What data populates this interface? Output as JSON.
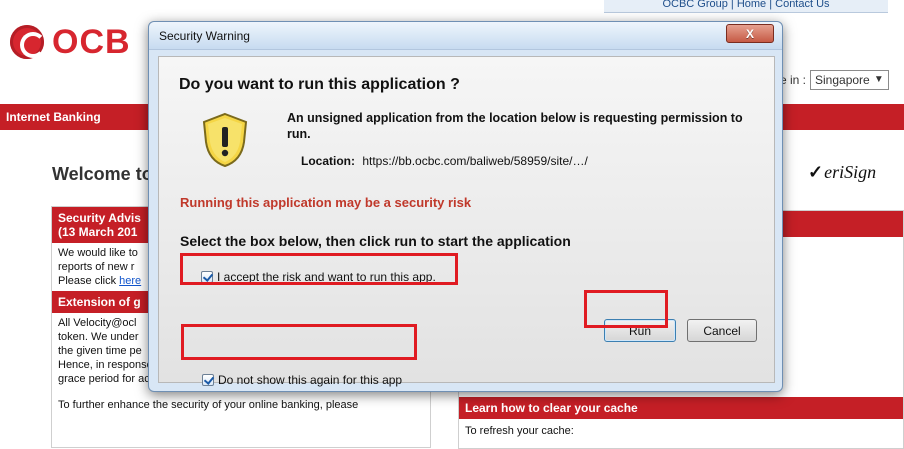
{
  "page": {
    "top_links": "OCBC Group | Home | Contact Us",
    "logo_text": "OCB",
    "country_label": "e in :",
    "country_value": "Singapore",
    "internet_banking": "Internet Banking",
    "welcome": "Welcome to",
    "verisign": "eriSign",
    "left_panel": {
      "security_header_line1": "Security Advis",
      "security_header_line2": "(13 March 201",
      "security_text_line1": "We would like to",
      "security_text_line2": "reports of new r",
      "security_text_line3_prefix": "Please click ",
      "security_text_link": "here",
      "extension_header": "Extension of g",
      "ext_line1": "All Velocity@ocl",
      "ext_line2": "token. We under",
      "ext_line3": "the given time pe",
      "ext_line4": "Hence, in response to feedback from you, we have extended the",
      "ext_line5": "grace period for activation of the new token till further notice.",
      "ext_line6": "To further enhance the security of your online banking, please"
    },
    "right_panel": {
      "cache_header": "Learn how to clear your cache",
      "cache_text": "To refresh your cache:"
    }
  },
  "dialog": {
    "title": "Security Warning",
    "close_label": "X",
    "heading": "Do you want to run this application ?",
    "request_text": "An unsigned application from the location below is requesting permission to run.",
    "location_label": "Location:",
    "location_value": "https://bb.ocbc.com/baliweb/58959/site/…/",
    "risk_text": "Running this application may be a security risk",
    "instruction": "Select the box below, then click run to start the application",
    "accept_checkbox": {
      "label": "I accept the risk and want to run this app.",
      "checked": true
    },
    "dont_show_checkbox": {
      "label": "Do not show this again for this app",
      "checked": true
    },
    "run_label": "Run",
    "cancel_label": "Cancel"
  },
  "colors": {
    "brand_red": "#c51f26",
    "dialog_frame": "#d8e6f5",
    "risk_text": "#c0392b",
    "highlight": "#e01b22"
  }
}
